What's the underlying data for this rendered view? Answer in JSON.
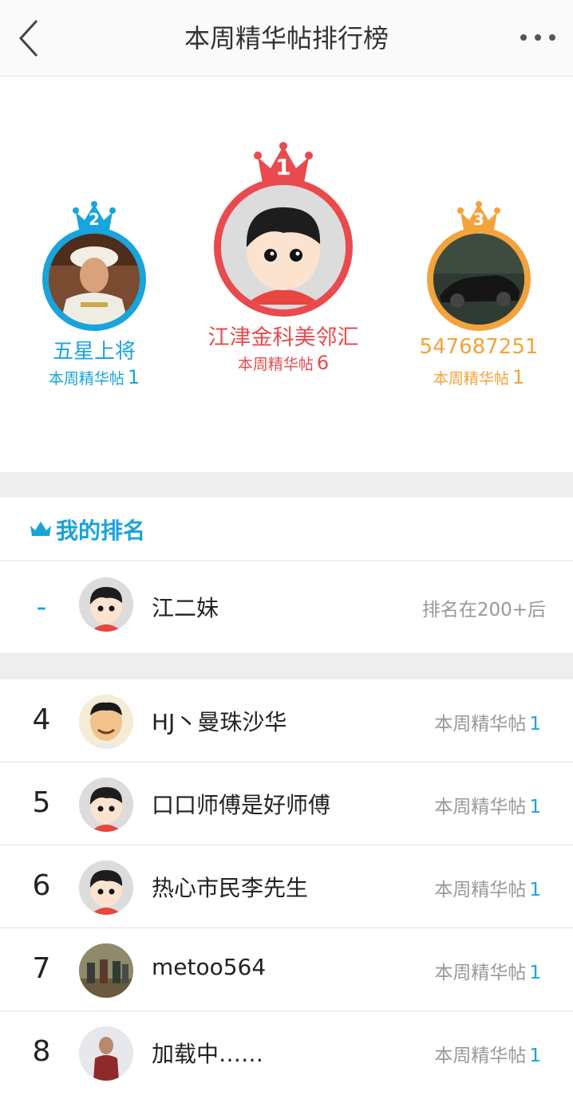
{
  "header": {
    "title": "本周精华帖排行榜",
    "back_icon": "chevron-left-icon",
    "more_icon": "more-dots-icon"
  },
  "podium": {
    "colors": {
      "first": "#e84a4e",
      "second": "#18a4dc",
      "third": "#f3a33b"
    },
    "first": {
      "rank": "1",
      "name": "江津金科美邻汇",
      "count_label": "本周精华帖",
      "count": "6"
    },
    "second": {
      "rank": "2",
      "name": "五星上将",
      "count_label": "本周精华帖",
      "count": "1"
    },
    "third": {
      "rank": "3",
      "name": "547687251",
      "count_label": "本周精华帖",
      "count": "1"
    }
  },
  "my_rank": {
    "title": "我的排名",
    "rank": "-",
    "name": "江二妹",
    "status": "排名在200+后"
  },
  "list": [
    {
      "rank": "4",
      "name": "HJ丶曼珠沙华",
      "label": "本周精华帖",
      "count": "1"
    },
    {
      "rank": "5",
      "name": "口口师傅是好师傅",
      "label": "本周精华帖",
      "count": "1"
    },
    {
      "rank": "6",
      "name": "热心市民李先生",
      "label": "本周精华帖",
      "count": "1"
    },
    {
      "rank": "7",
      "name": "metoo564",
      "label": "本周精华帖",
      "count": "1"
    },
    {
      "rank": "8",
      "name": "加载中……",
      "label": "本周精华帖",
      "count": "1"
    }
  ]
}
